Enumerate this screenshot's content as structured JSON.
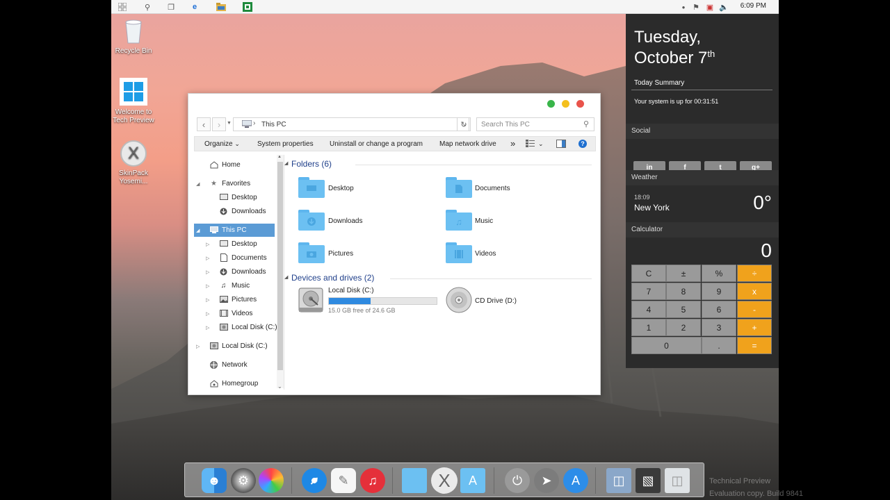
{
  "taskbar": {
    "clock": "6:09 PM"
  },
  "desktop_icons": [
    {
      "label_line1": "Recycle Bin",
      "label_line2": ""
    },
    {
      "label_line1": "Welcome to",
      "label_line2": "Tech Preview"
    },
    {
      "label_line1": "SkinPack",
      "label_line2": "Yosemi..."
    }
  ],
  "explorer": {
    "address": "This PC",
    "search_placeholder": "Search This PC",
    "toolbar": {
      "organize": "Organize",
      "system_properties": "System properties",
      "uninstall": "Uninstall or change a program",
      "map_drive": "Map network drive",
      "more": "»"
    },
    "nav": {
      "home": "Home",
      "favorites": "Favorites",
      "fav_desktop": "Desktop",
      "fav_downloads": "Downloads",
      "this_pc": "This PC",
      "pc_desktop": "Desktop",
      "pc_documents": "Documents",
      "pc_downloads": "Downloads",
      "pc_music": "Music",
      "pc_pictures": "Pictures",
      "pc_videos": "Videos",
      "pc_local_disk": "Local Disk (C:)",
      "local_disk": "Local Disk (C:)",
      "network": "Network",
      "homegroup": "Homegroup"
    },
    "folders_header": "Folders (6)",
    "folders": [
      "Desktop",
      "Documents",
      "Downloads",
      "Music",
      "Pictures",
      "Videos"
    ],
    "devices_header": "Devices and drives (2)",
    "local_disk": {
      "name": "Local Disk (C:)",
      "free": "15.0 GB free of 24.6 GB",
      "used_fraction": 0.39
    },
    "cd_drive": "CD Drive (D:)"
  },
  "panel": {
    "day": "Tuesday,",
    "date": "October 7",
    "date_sup": "th",
    "today_summary": "Today Summary",
    "uptime": "Your system is up for 00:31:51",
    "social": "Social",
    "social_buttons": [
      "in",
      "f",
      "t",
      "g+"
    ],
    "weather": "Weather",
    "weather_time": "18:09",
    "weather_city": "New York",
    "weather_temp": "0°",
    "calculator": "Calculator",
    "calc_display": "0",
    "calc_keys": [
      "C",
      "±",
      "%",
      "÷",
      "7",
      "8",
      "9",
      "x",
      "4",
      "5",
      "6",
      "-",
      "1",
      "2",
      "3",
      "+",
      "0",
      ".",
      "="
    ]
  },
  "watermark": {
    "line1": "Technical Preview",
    "line2": "Evaluation copy. Build 9841"
  },
  "colors": {
    "accent_orange": "#f0a21c",
    "selection": "#5b9bd5",
    "folder_blue": "#6cc0f2"
  }
}
